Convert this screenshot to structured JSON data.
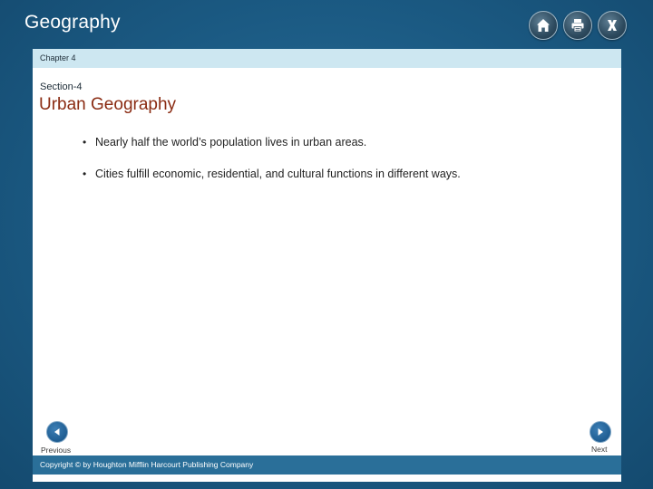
{
  "app": {
    "title": "Geography"
  },
  "toolbar": {
    "home_icon": "home-icon",
    "print_icon": "print-icon",
    "close_icon": "close-icon"
  },
  "header": {
    "chapter": "Chapter 4"
  },
  "main": {
    "section": "Section-4",
    "title": "Urban Geography",
    "bullets": [
      "Nearly half the world’s population lives in urban areas.",
      "Cities fulfill economic, residential, and cultural functions in different ways."
    ]
  },
  "nav": {
    "previous_label": "Previous",
    "next_label": "Next"
  },
  "footer": {
    "copyright": "Copyright © by Houghton Mifflin Harcourt Publishing Company"
  },
  "colors": {
    "background": "#1b5a83",
    "chapter_bar": "#cde7f1",
    "title": "#8a2b12",
    "footer_bar": "#2a6f99",
    "nav_button": "#1f5d92"
  }
}
